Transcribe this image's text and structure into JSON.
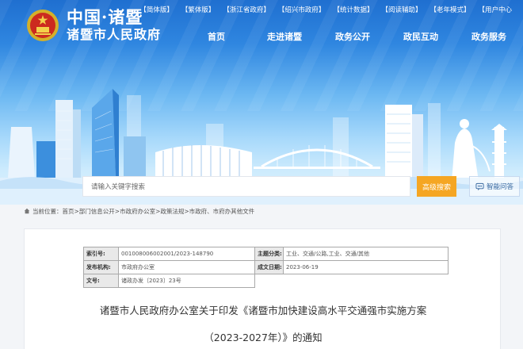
{
  "header": {
    "site_cn": "中国·诸暨",
    "site_gov": "诸暨市人民政府",
    "top_links": [
      "【简体版】",
      "【繁体版】",
      "【浙江省政府】",
      "【绍兴市政府】",
      "【统计数据】",
      "【阅读辅助】",
      "【老年模式】",
      "【用户中心"
    ],
    "nav": [
      "首页",
      "走进诸暨",
      "政务公开",
      "政民互动",
      "政务服务"
    ]
  },
  "search": {
    "placeholder": "请输入关键字搜索",
    "advanced_label": "高级搜索",
    "smart_label": "智能问答"
  },
  "breadcrumb": {
    "text": "当前位置：首页>部门信息公开>市政府办公室>政策法规>市政府、市府办其他文件"
  },
  "article": {
    "meta": {
      "index_label": "索引号:",
      "index_value": "001008006002001/2023-148790",
      "topic_label": "主题分类:",
      "topic_value": "工业、交通/公路,工业、交通/其他",
      "publisher_label": "发布机构:",
      "publisher_value": "市政府办公室",
      "date_label": "成文日期:",
      "date_value": "2023-06-19",
      "docno_label": "文号:",
      "docno_value": "诸政办发〔2023〕23号"
    },
    "title_line1": "诸暨市人民政府办公室关于印发《诸暨市加快建设高水平交通强市实施方案",
    "title_line2": "（2023-2027年）》的通知"
  },
  "colors": {
    "primary_blue": "#2a7ad8",
    "search_orange": "#f5a623"
  }
}
